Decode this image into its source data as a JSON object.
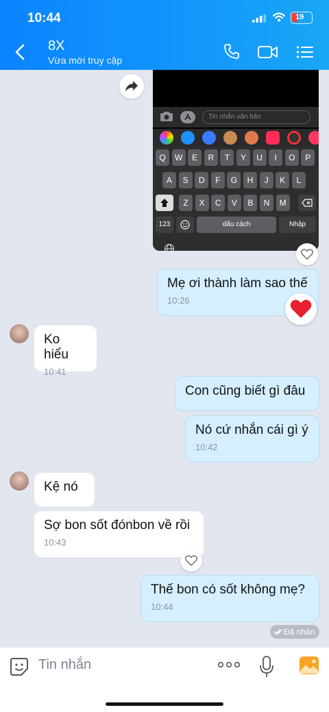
{
  "status_bar": {
    "time": "10:44",
    "battery": "19"
  },
  "header": {
    "title": "8X",
    "subtitle": "Vừa mới truy cập"
  },
  "screenshot": {
    "input_placeholder": "Tin nhắn văn bản",
    "row1": [
      "Q",
      "W",
      "E",
      "R",
      "T",
      "Y",
      "U",
      "I",
      "O",
      "P"
    ],
    "row2": [
      "A",
      "S",
      "D",
      "F",
      "G",
      "H",
      "J",
      "K",
      "L"
    ],
    "row3": [
      "Z",
      "X",
      "C",
      "V",
      "B",
      "N",
      "M"
    ],
    "num_key": "123",
    "space_key": "dấu cách",
    "return_key": "Nhập"
  },
  "messages": [
    {
      "side": "me",
      "text": "Mẹ ơi thành làm sao thế",
      "time": "10:26",
      "reaction": "heart"
    },
    {
      "side": "them",
      "text": "Ko hiểu",
      "time": "10:41"
    },
    {
      "side": "me",
      "text": "Con cũng biết gì đâu",
      "time": ""
    },
    {
      "side": "me",
      "text": "Nó cứ nhắn cái gì ý",
      "time": "10:42"
    },
    {
      "side": "them",
      "text": "Kệ nó",
      "time": ""
    },
    {
      "side": "them",
      "text": "Sợ bon sốt đónbon về rồi",
      "time": "10:43"
    },
    {
      "side": "me",
      "text": "Thế bon có sốt không mẹ?",
      "time": "10:44"
    }
  ],
  "delivery_status": "Đã nhận",
  "composer": {
    "placeholder": "Tin nhắn"
  },
  "colors": {
    "header": "#0a84ff",
    "me_bubble": "#d5efff",
    "them_bubble": "#ffffff",
    "background": "#e2e6ee"
  }
}
